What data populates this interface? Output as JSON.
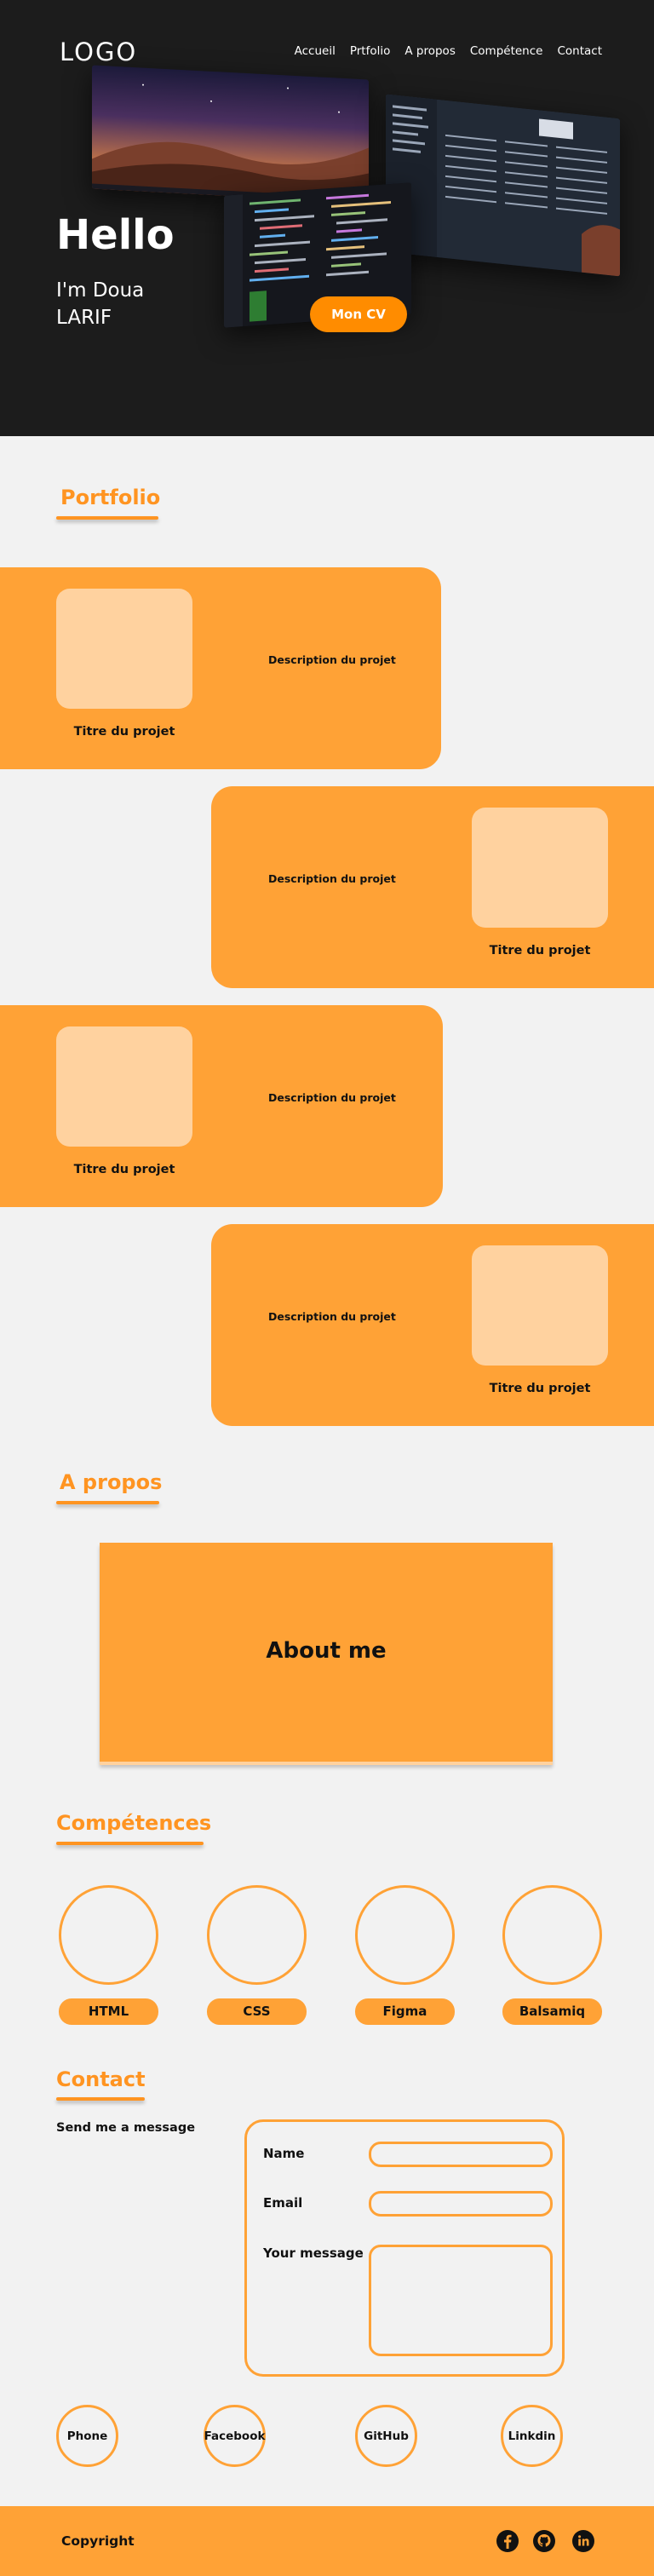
{
  "header": {
    "logo": "LOGO",
    "nav": [
      "Accueil",
      "Prtfolio",
      "A propos",
      "Compétence",
      "Contact"
    ]
  },
  "hero": {
    "hello": "Hello",
    "name": "I'm Doua LARIF",
    "cv_button": "Mon CV"
  },
  "portfolio": {
    "title": "Portfolio",
    "projects": [
      {
        "title": "Titre du projet",
        "description": "Description du projet"
      },
      {
        "title": "Titre du projet",
        "description": "Description du projet"
      },
      {
        "title": "Titre du projet",
        "description": "Description du projet"
      },
      {
        "title": "Titre du projet",
        "description": "Description du projet"
      }
    ]
  },
  "about": {
    "title": "A propos",
    "box_text": "About me"
  },
  "skills": {
    "title": "Compétences",
    "items": [
      "HTML",
      "CSS",
      "Figma",
      "Balsamiq"
    ]
  },
  "contact": {
    "title": "Contact",
    "send_label": "Send me a message",
    "name_label": "Name",
    "email_label": "Email",
    "message_label": "Your message",
    "name_value": "",
    "email_value": "",
    "message_value": ""
  },
  "socials": [
    "Phone",
    "Facebook",
    "GitHub",
    "Linkdin"
  ],
  "footer": {
    "copyright": "Copyright",
    "icons": [
      "facebook-icon",
      "github-icon",
      "linkedin-icon"
    ]
  },
  "colors": {
    "accent": "#ffa236",
    "accent_text": "#ff9421",
    "hero_bg": "#1c1c1c",
    "thumb": "#ffd29f",
    "page_bg": "#f2f2f2"
  }
}
